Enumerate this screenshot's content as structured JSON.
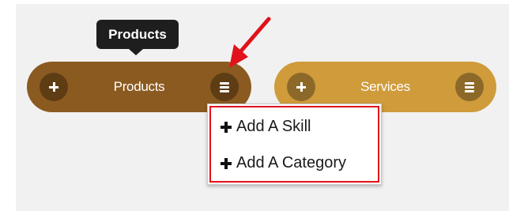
{
  "tooltip": {
    "text": "Products"
  },
  "pills": [
    {
      "label": "Products",
      "color": "#8b5a20"
    },
    {
      "label": "Services",
      "color": "#cf9b3b"
    }
  ],
  "dropdown": {
    "items": [
      {
        "label": "Add A Skill",
        "icon": "plus-icon"
      },
      {
        "label": "Add A Category",
        "icon": "plus-icon"
      }
    ],
    "highlight_color": "#e0121b"
  },
  "annotation": {
    "arrow_color": "#e0121b"
  }
}
